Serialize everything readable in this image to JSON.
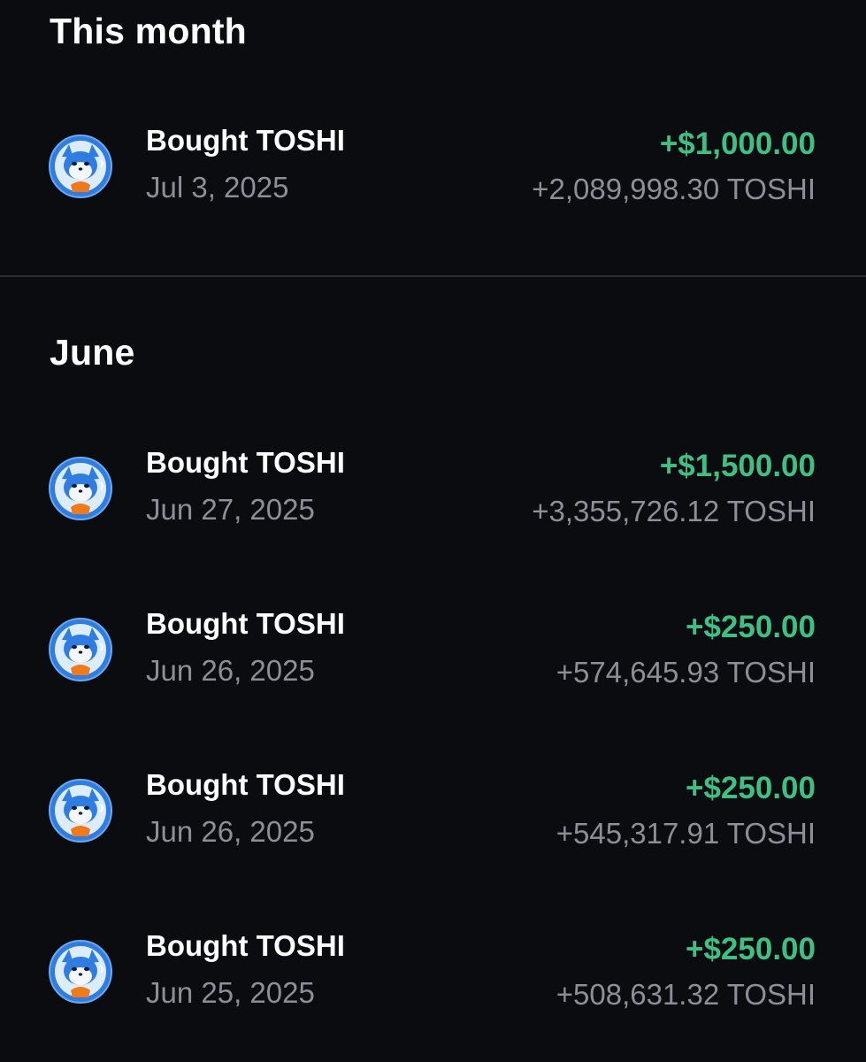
{
  "sections": [
    {
      "title": "This month",
      "transactions": [
        {
          "title": "Bought TOSHI",
          "date": "Jul 3, 2025",
          "fiat": "+$1,000.00",
          "crypto": "+2,089,998.30 TOSHI",
          "icon": "toshi-token-icon"
        }
      ]
    },
    {
      "title": "June",
      "transactions": [
        {
          "title": "Bought TOSHI",
          "date": "Jun 27, 2025",
          "fiat": "+$1,500.00",
          "crypto": "+3,355,726.12 TOSHI",
          "icon": "toshi-token-icon"
        },
        {
          "title": "Bought TOSHI",
          "date": "Jun 26, 2025",
          "fiat": "+$250.00",
          "crypto": "+574,645.93 TOSHI",
          "icon": "toshi-token-icon"
        },
        {
          "title": "Bought TOSHI",
          "date": "Jun 26, 2025",
          "fiat": "+$250.00",
          "crypto": "+545,317.91 TOSHI",
          "icon": "toshi-token-icon"
        },
        {
          "title": "Bought TOSHI",
          "date": "Jun 25, 2025",
          "fiat": "+$250.00",
          "crypto": "+508,631.32 TOSHI",
          "icon": "toshi-token-icon"
        }
      ]
    }
  ],
  "colors": {
    "background": "#0b0c0f",
    "positive": "#3fbf84",
    "secondary_text": "#8a8f98",
    "primary_text": "#ffffff",
    "token_blue": "#2f7de1"
  }
}
